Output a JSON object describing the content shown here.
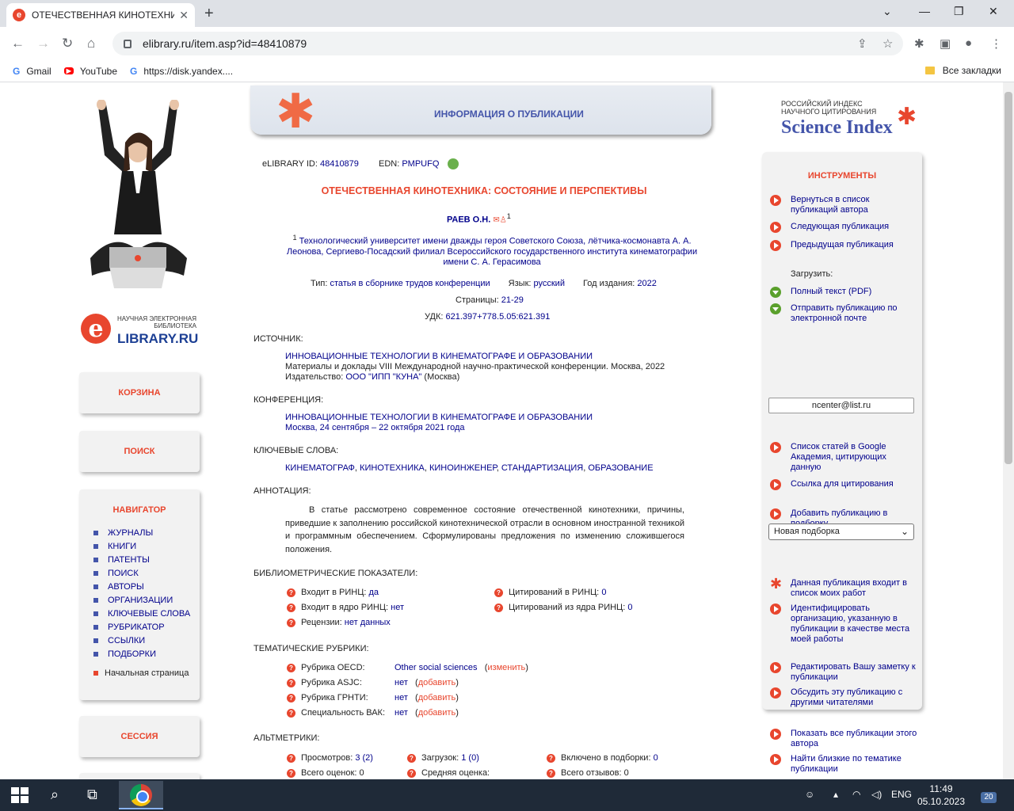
{
  "browser": {
    "tab_title": "ОТЕЧЕСТВЕННАЯ КИНОТЕХНИКА",
    "url": "elibrary.ru/item.asp?id=48410879",
    "bookmarks": [
      "Gmail",
      "YouTube",
      "https://disk.yandex...."
    ],
    "bookmarks_right": "Все закладки"
  },
  "left": {
    "logo_caption": "НАУЧНАЯ ЭЛЕКТРОННАЯ БИБЛИОТЕКА",
    "logo_name": "LIBRARY.RU",
    "cart": "КОРЗИНА",
    "search": "ПОИСК",
    "navigator": {
      "title": "НАВИГАТОР",
      "items": [
        "ЖУРНАЛЫ",
        "КНИГИ",
        "ПАТЕНТЫ",
        "ПОИСК",
        "АВТОРЫ",
        "ОРГАНИЗАЦИИ",
        "КЛЮЧЕВЫЕ СЛОВА",
        "РУБРИКАТОР",
        "ССЫЛКИ",
        "ПОДБОРКИ"
      ],
      "home": "Начальная страница"
    },
    "session": "СЕССИЯ"
  },
  "header_title": "ИНФОРМАЦИЯ О ПУБЛИКАЦИИ",
  "pub": {
    "elib_label": "eLIBRARY ID:",
    "elib_id": "48410879",
    "edn_label": "EDN:",
    "edn": "PMPUFQ",
    "title": "ОТЕЧЕСТВЕННАЯ КИНОТЕХНИКА: СОСТОЯНИЕ И ПЕРСПЕКТИВЫ",
    "author": "РАЕВ О.Н.",
    "affil_sup": "1",
    "affiliation_sup": "1",
    "affiliation_l1": "Технологический университет имени дважды героя Советского Союза, лётчика-космонавта А. А.",
    "affiliation_l2": "Леонова, Сергиево-Посадский филиал Всероссийского государственного института кинематографии",
    "affiliation_l3": "имени С. А. Герасимова",
    "type_label": "Тип:",
    "type": "статья в сборнике трудов конференции",
    "lang_label": "Язык:",
    "lang": "русский",
    "year_label": "Год издания:",
    "year": "2022",
    "pages_label": "Страницы:",
    "pages": "21-29",
    "udk_label": "УДК:",
    "udk": "621.397+778.5.05:621.391",
    "source_label": "ИСТОЧНИК:",
    "source_title": "ИННОВАЦИОННЫЕ ТЕХНОЛОГИИ В КИНЕМАТОГРАФЕ И ОБРАЗОВАНИИ",
    "source_desc": "Материалы и доклады VIII Международной научно-практической конференции. Москва, 2022",
    "publisher_label": "Издательство:",
    "publisher": "ООО \"ИПП \"КУНА\"",
    "publisher_city": "(Москва)",
    "conf_label": "КОНФЕРЕНЦИЯ:",
    "conf_title": "ИННОВАЦИОННЫЕ ТЕХНОЛОГИИ В КИНЕМАТОГРАФЕ И ОБРАЗОВАНИИ",
    "conf_place": "Москва, 24 сентября – 22 октября 2021 года",
    "kw_label": "КЛЮЧЕВЫЕ СЛОВА:",
    "keywords": [
      "КИНЕМАТОГРАФ",
      "КИНОТЕХНИКА",
      "КИНОИНЖЕНЕР",
      "СТАНДАРТИЗАЦИЯ",
      "ОБРАЗОВАНИЕ"
    ],
    "abstract_label": "АННОТАЦИЯ:",
    "abstract": "В статье рассмотрено современное состояние отечественной кинотехники, причины, приведшие к заполнению российской кинотехнической отрасли в основном иностранной техникой и программным обеспечением. Сформулированы предложения по изменению сложившегося положения.",
    "biblio_label": "БИБЛИОМЕТРИЧЕСКИЕ ПОКАЗАТЕЛИ:",
    "biblio": {
      "rinc_label": "Входит в РИНЦ:",
      "rinc": "да",
      "core_label": "Входит в ядро РИНЦ:",
      "core": "нет",
      "reviews_label": "Рецензии:",
      "reviews": "нет данных",
      "cit_label": "Цитирований в РИНЦ:",
      "cit": "0",
      "cit_core_label": "Цитирований из ядра РИНЦ:",
      "cit_core": "0"
    },
    "rubrics_label": "ТЕМАТИЧЕСКИЕ РУБРИКИ:",
    "rubrics": [
      {
        "label": "Рубрика OECD:",
        "value": "Other social sciences",
        "action": "изменить"
      },
      {
        "label": "Рубрика ASJC:",
        "value": "нет",
        "action": "добавить"
      },
      {
        "label": "Рубрика ГРНТИ:",
        "value": "нет",
        "action": "добавить"
      },
      {
        "label": "Специальность ВАК:",
        "value": "нет",
        "action": "добавить"
      }
    ],
    "alt_label": "АЛЬТМЕТРИКИ:",
    "alt": {
      "views_label": "Просмотров:",
      "views": "3 (2)",
      "downloads_label": "Загрузок:",
      "downloads": "1 (0)",
      "incol_label": "Включено в подборки:",
      "incol": "0",
      "ratings_label": "Всего оценок:",
      "ratings": "0",
      "avg_label": "Средняя оценка:",
      "rev_label": "Всего отзывов:",
      "rev": "0"
    }
  },
  "science_index": {
    "line1": "РОССИЙСКИЙ ИНДЕКС",
    "line2": "НАУЧНОГО ЦИТИРОВАНИЯ",
    "name": "Science Index"
  },
  "tools": {
    "title": "ИНСТРУМЕНТЫ",
    "back": "Вернуться в список публикаций автора",
    "next": "Следующая публикация",
    "prev": "Предыдущая публикация",
    "download_label": "Загрузить:",
    "fulltext": "Полный текст (PDF)",
    "send": "Отправить публикацию по электронной почте",
    "email": "ncenter@list.ru",
    "google": "Список статей в Google Академия, цитирующих данную",
    "cite": "Ссылка для цитирования",
    "add_sel": "Добавить публикацию в подборку",
    "sel_value": "Новая подборка",
    "mywork": "Данная публикация входит в список моих работ",
    "identify": "Идентифицировать организацию, указанную в публикации в качестве места моей работы",
    "note": "Редактировать Вашу заметку к публикации",
    "discuss": "Обсудить эту публикацию с другими читателями",
    "showall": "Показать все публикации этого автора",
    "similar": "Найти близкие по тематике публикации"
  },
  "taskbar": {
    "lang": "ENG",
    "time": "11:49",
    "date": "05.10.2023",
    "notif": "20"
  }
}
